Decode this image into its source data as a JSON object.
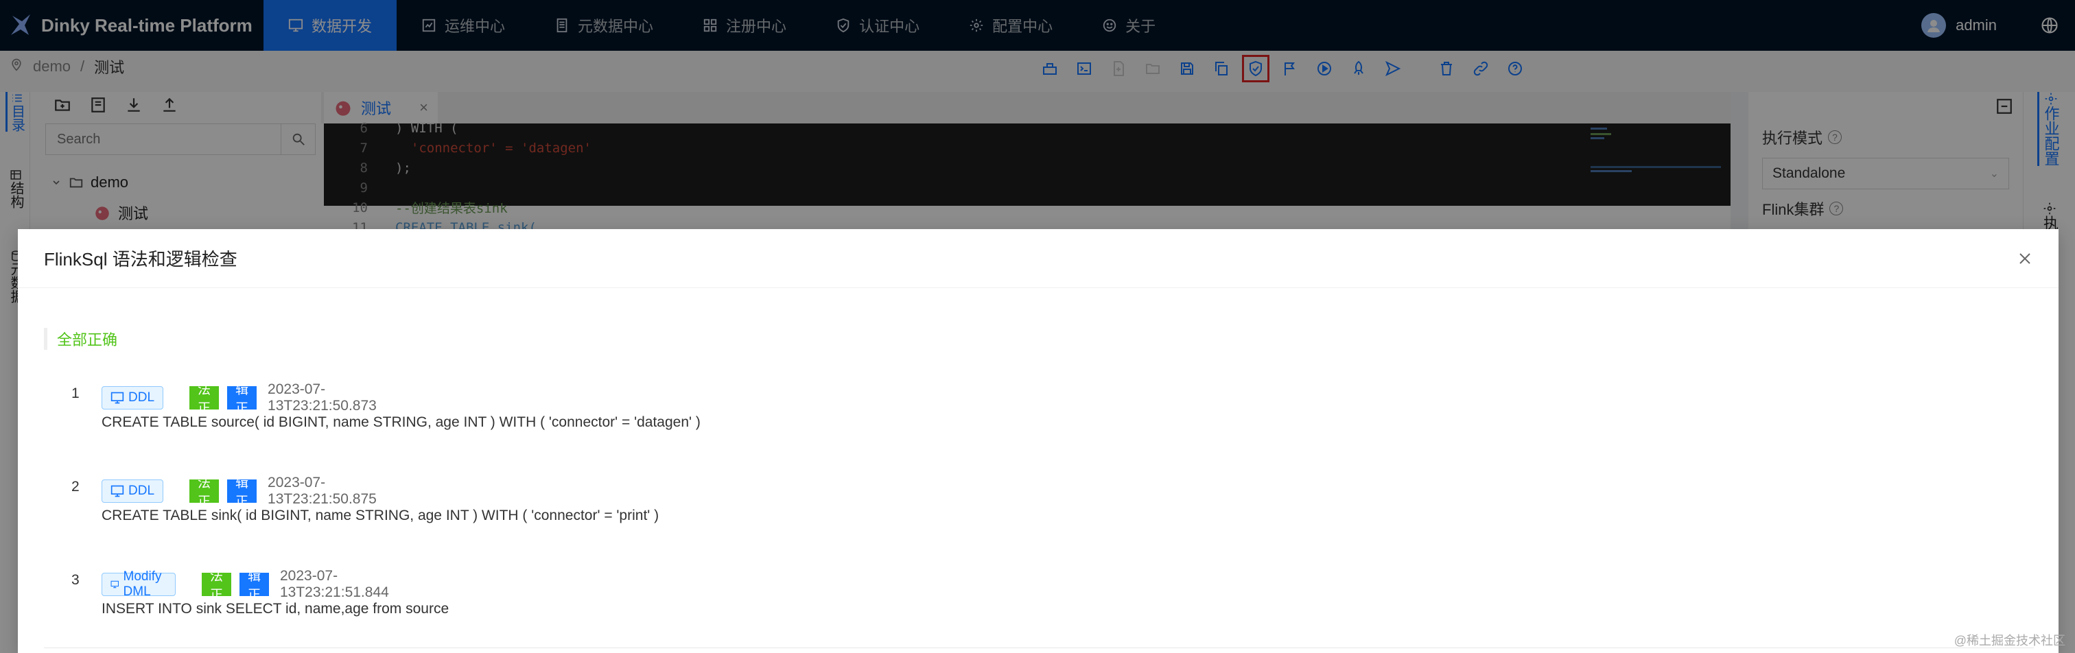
{
  "colors": {
    "nav_bg": "#001529",
    "accent": "#1677ff",
    "success": "#52c41a",
    "selected_outline": "#e02424"
  },
  "header": {
    "brand": "Dinky Real-time Platform",
    "menu": [
      {
        "label": "数据开发",
        "icon": "desktop-icon",
        "active": true
      },
      {
        "label": "运维中心",
        "icon": "monitor-icon"
      },
      {
        "label": "元数据中心",
        "icon": "book-icon"
      },
      {
        "label": "注册中心",
        "icon": "grid-icon"
      },
      {
        "label": "认证中心",
        "icon": "shield-icon"
      },
      {
        "label": "配置中心",
        "icon": "gear-icon"
      },
      {
        "label": "关于",
        "icon": "smile-icon"
      }
    ],
    "user": "admin"
  },
  "breadcrumb": {
    "root": "demo",
    "separator": "/",
    "current": "测试"
  },
  "toolbar": {
    "buttons": [
      "structure-icon",
      "console-icon",
      "file-add-icon",
      "folder-open-icon",
      "save-icon",
      "copy-icon",
      "check-sql-icon",
      "flag-icon",
      "run-icon",
      "submit-icon",
      "send-icon",
      "delete-icon",
      "link-icon",
      "help-icon"
    ],
    "selected": "check-sql-icon"
  },
  "left_rail": {
    "items": [
      "目录",
      "结构",
      "元数据"
    ]
  },
  "left_panel": {
    "search_placeholder": "Search",
    "tree": {
      "folder": "demo",
      "file": "测试"
    }
  },
  "editor": {
    "tab_label": "测试",
    "tab_close": "×",
    "lines": [
      {
        "num": "6",
        "text": ") WITH ("
      },
      {
        "num": "7",
        "text": "  'connector' = 'datagen'"
      },
      {
        "num": "8",
        "text": ");"
      },
      {
        "num": "9",
        "text": ""
      },
      {
        "num": "10",
        "text": "--创建结果表sink"
      },
      {
        "num": "11",
        "text": "CREATE TABLE sink("
      }
    ]
  },
  "right_panel": {
    "exec_mode_label": "执行模式",
    "exec_mode_value": "Standalone",
    "cluster_label": "Flink集群"
  },
  "right_rail": {
    "items": [
      "作业配置",
      "执行配置"
    ]
  },
  "modal": {
    "title": "FlinkSql 语法和逻辑检查",
    "result_title": "全部正确",
    "items": [
      {
        "index": "1",
        "type": "DDL",
        "syntax": "语法正确",
        "logic": "逻辑正确",
        "time": "2023-07-13T23:21:50.873",
        "sql": "CREATE TABLE source( id BIGINT, name STRING, age INT ) WITH ( 'connector' = 'datagen' )"
      },
      {
        "index": "2",
        "type": "DDL",
        "syntax": "语法正确",
        "logic": "逻辑正确",
        "time": "2023-07-13T23:21:50.875",
        "sql": "CREATE TABLE sink( id BIGINT, name STRING, age INT ) WITH ( 'connector' = 'print' )"
      },
      {
        "index": "3",
        "type": "Modify DML",
        "syntax": "语法正确",
        "logic": "逻辑正确",
        "time": "2023-07-13T23:21:51.844",
        "sql": "INSERT INTO sink SELECT id, name,age from source"
      }
    ]
  },
  "watermark": "@稀土掘金技术社区"
}
